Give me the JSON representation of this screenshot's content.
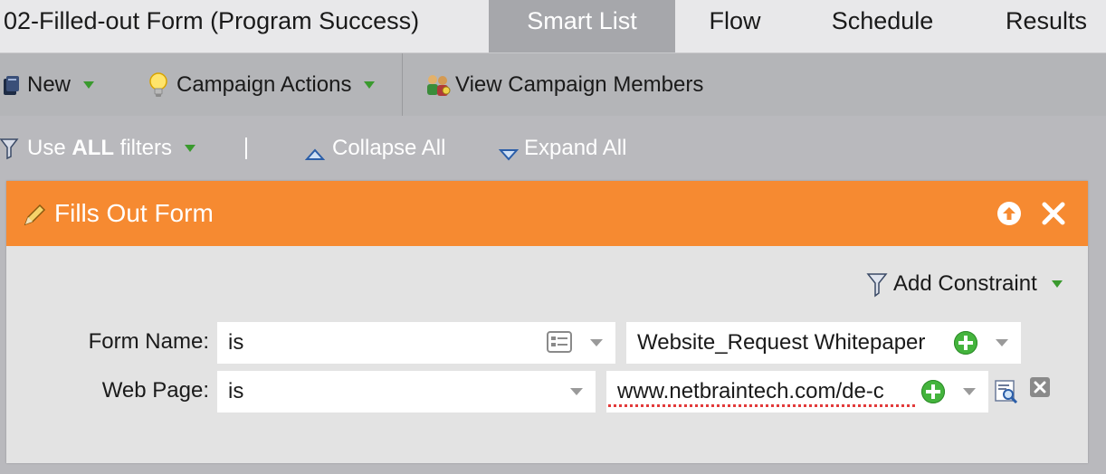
{
  "header": {
    "campaign_title": "02-Filled-out Form (Program Success)",
    "tabs": [
      {
        "label": "Smart List",
        "active": true
      },
      {
        "label": "Flow",
        "active": false
      },
      {
        "label": "Schedule",
        "active": false
      },
      {
        "label": "Results",
        "active": false
      }
    ]
  },
  "toolbar": {
    "new_label": "New",
    "campaign_actions_label": "Campaign Actions",
    "view_members_label": "View Campaign Members"
  },
  "filterbar": {
    "use_prefix": "Use ",
    "use_bold": "ALL",
    "use_suffix": " filters",
    "collapse_label": "Collapse All",
    "expand_label": "Expand All"
  },
  "filter": {
    "title": "Fills Out Form",
    "add_constraint_label": "Add Constraint",
    "rows": [
      {
        "label": "Form Name:",
        "operator": "is",
        "value": "Website_Request Whitepaper"
      },
      {
        "label": "Web Page:",
        "operator": "is",
        "value": "www.netbraintech.com/de-c"
      }
    ]
  },
  "colors": {
    "header_orange": "#f68a31",
    "active_tab": "#a6a7ab",
    "toolbar_bg": "#b4b5b8",
    "add_green": "#44b43d"
  },
  "icons": [
    "new-icon",
    "lightbulb-icon",
    "members-icon",
    "funnel-icon",
    "collapse-triangle-icon",
    "expand-triangle-icon",
    "pencil-icon",
    "move-up-icon",
    "close-icon",
    "funnel-constraint-icon",
    "list-icon",
    "lookup-icon",
    "remove-icon"
  ]
}
